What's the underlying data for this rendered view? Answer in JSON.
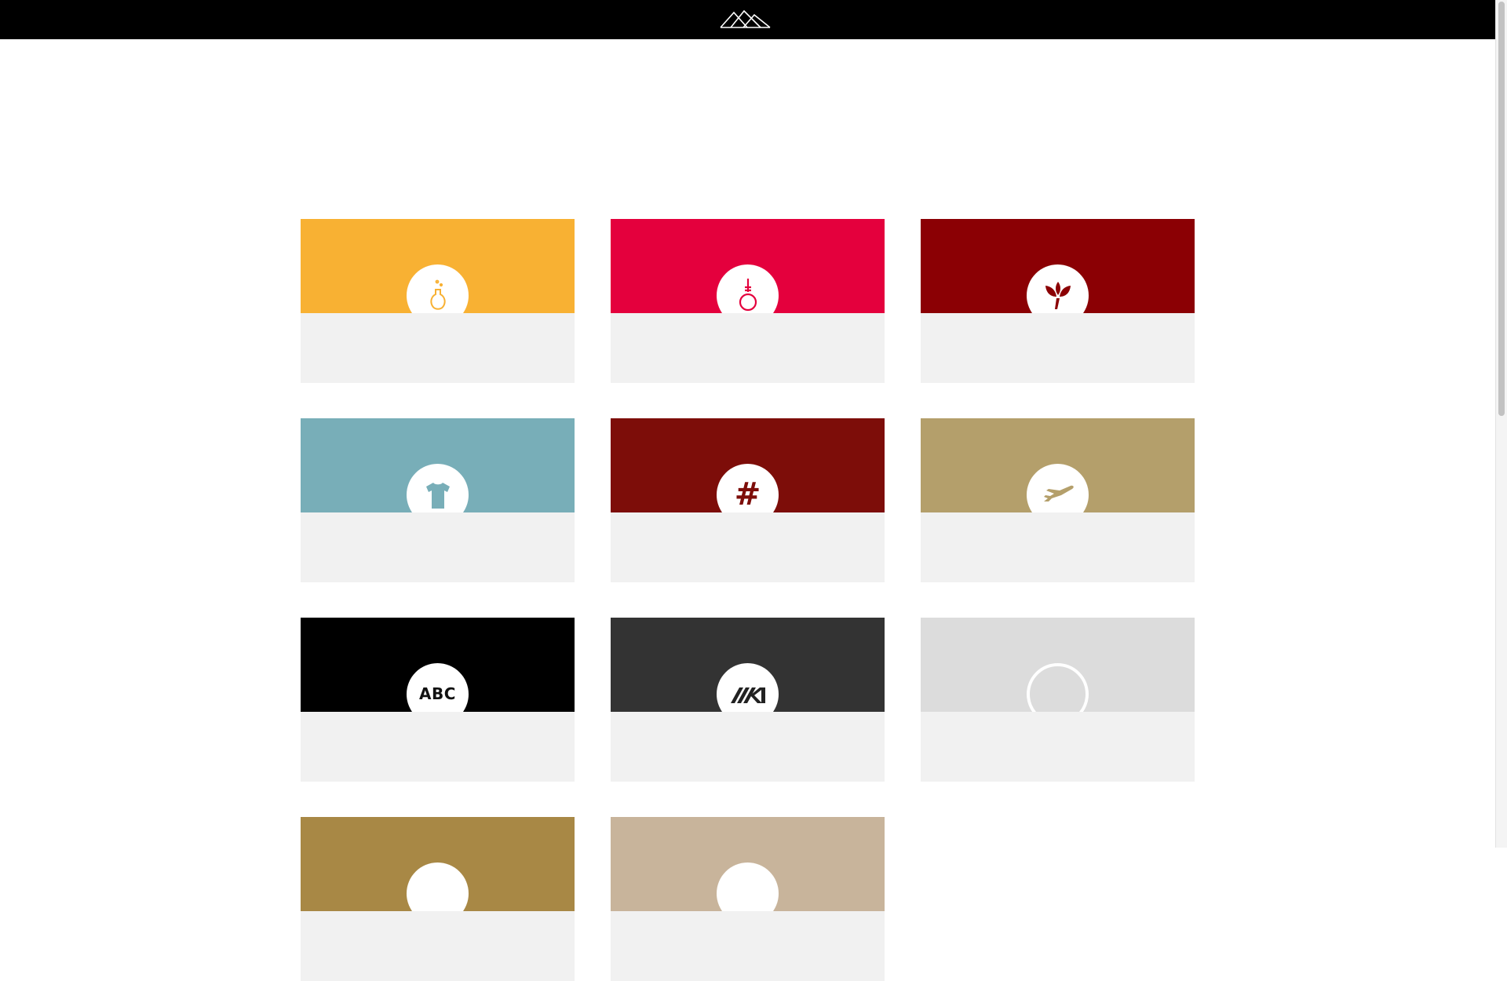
{
  "header": {
    "logo_icon": "mountain-logo-icon",
    "background": "#000000"
  },
  "cards": [
    {
      "icon": "flask-icon",
      "color": "#f8b133"
    },
    {
      "icon": "noose-icon",
      "color": "#e4003d"
    },
    {
      "icon": "sprout-icon",
      "color": "#8b0004"
    },
    {
      "icon": "tshirt-icon",
      "color": "#78aeb8"
    },
    {
      "icon": "hash-icon",
      "color": "#7d0d09",
      "glyph": "#"
    },
    {
      "icon": "airplane-icon",
      "color": "#b49f6b"
    },
    {
      "icon": "abc-text-icon",
      "color": "#000000",
      "glyph": "ABC"
    },
    {
      "icon": "mk-logo-icon",
      "color": "#333333"
    },
    {
      "icon": "empty-ring-icon",
      "color": "#dcdcdc"
    },
    {
      "icon": "unknown-icon",
      "color": "#a88845"
    },
    {
      "icon": "unknown-icon",
      "color": "#c8b49b"
    }
  ],
  "colors": {
    "card_body": "#f1f1f1",
    "page_background": "#ffffff"
  }
}
